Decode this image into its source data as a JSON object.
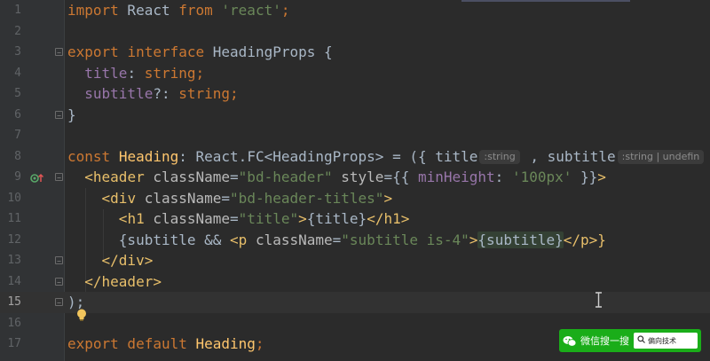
{
  "editor": {
    "current_line": 15,
    "lines": [
      {
        "number": "1"
      },
      {
        "number": "2"
      },
      {
        "number": "3"
      },
      {
        "number": "4"
      },
      {
        "number": "5"
      },
      {
        "number": "6"
      },
      {
        "number": "7"
      },
      {
        "number": "8"
      },
      {
        "number": "9"
      },
      {
        "number": "10"
      },
      {
        "number": "11"
      },
      {
        "number": "12"
      },
      {
        "number": "13"
      },
      {
        "number": "14"
      },
      {
        "number": "15"
      },
      {
        "number": "16"
      },
      {
        "number": "17"
      }
    ],
    "tokens": {
      "l1": {
        "import": "import",
        "react": " React ",
        "from": "from",
        "mod": "'react'",
        "semi": ";"
      },
      "l3": {
        "export": "export",
        "interface": "interface",
        "name": "HeadingProps",
        "brace": " {"
      },
      "l4": {
        "prop": "title",
        "colon": ": ",
        "type": "string",
        "semi": ";"
      },
      "l5": {
        "prop": "subtitle",
        "colon": "?: ",
        "type": "string",
        "semi": ";"
      },
      "l6": {
        "brace": "}"
      },
      "l8": {
        "const": "const",
        "name": "Heading",
        "colon": ": ",
        "type": "React.FC<HeadingProps> = ({ ",
        "p1": "title",
        "hint1": ":string",
        "comma": " , ",
        "p2": "subtitle",
        "hint2": ":string | undefin"
      },
      "l9": {
        "open": "<",
        "tag": "header",
        "attr1": " className",
        "eq1": "=",
        "val1": "\"bd-header\"",
        "attr2": " style",
        "eq2": "={{ ",
        "key": "minHeight",
        "colon": ": ",
        "val2": "'100px'",
        "close": " }}",
        "gt": ">"
      },
      "l10": {
        "open": "<",
        "tag": "div",
        "attr": " className",
        "eq": "=",
        "val": "\"bd-header-titles\"",
        "gt": ">"
      },
      "l11": {
        "open": "<",
        "tag": "h1",
        "attr": " className",
        "eq": "=",
        "val": "\"title\"",
        "gt": ">",
        "expr": "{title}",
        "close_open": "</",
        "close_tag": "h1",
        "close_gt": ">"
      },
      "l12": {
        "pre": "{subtitle && ",
        "open": "<",
        "tag": "p",
        "attr": " className",
        "eq": "=",
        "val": "\"subtitle is-4\"",
        "gt": ">",
        "expr": "{subtitle}",
        "close_open": "</",
        "close_tag": "p",
        "close_gt": ">}"
      },
      "l13": {
        "open": "</",
        "tag": "div",
        "gt": ">"
      },
      "l14": {
        "open": "</",
        "tag": "header",
        "gt": ">"
      },
      "l15": {
        "text": ");"
      },
      "l17": {
        "export": "export",
        "default": " default",
        "name": " Heading",
        "semi": ";"
      }
    }
  },
  "watermark": {
    "label": "微信搜一搜",
    "search_text": "偏向技术",
    "brand_color": "#1aad19"
  },
  "icons": {
    "gutter_icon": "implemented-override-icon",
    "bulb": "lightbulb-icon",
    "cursor": "i-beam-cursor-icon"
  }
}
